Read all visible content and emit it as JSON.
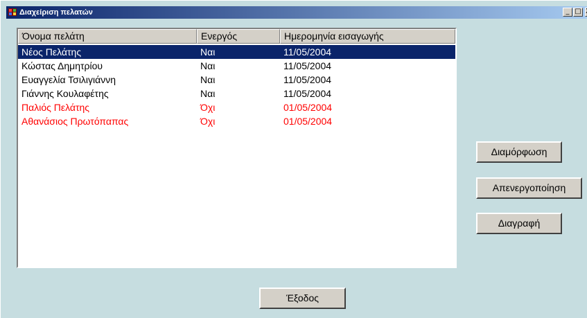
{
  "window": {
    "title": "Διαχείριση πελατών",
    "controls": {
      "minimize": "_",
      "maximize": "□",
      "close": "X"
    }
  },
  "list": {
    "columns": [
      "Όνομα πελάτη",
      "Ενεργός",
      "Ημερομηνία εισαγωγής"
    ],
    "rows": [
      {
        "name": "Νέος Πελάτης",
        "active": "Ναι",
        "date": "11/05/2004"
      },
      {
        "name": "Κώστας Δημητρίου",
        "active": "Ναι",
        "date": "11/05/2004"
      },
      {
        "name": "Ευαγγελία Τσιλιγιάννη",
        "active": "Ναι",
        "date": "11/05/2004"
      },
      {
        "name": "Γιάννης Κουλαφέτης",
        "active": "Ναι",
        "date": "11/05/2004"
      },
      {
        "name": "Παλιός Πελάτης",
        "active": "Όχι",
        "date": "01/05/2004"
      },
      {
        "name": "Αθανάσιος Πρωτόπαπας",
        "active": "Όχι",
        "date": "01/05/2004"
      }
    ],
    "selected_row": 0,
    "colors": {
      "selection": "#0a246a",
      "inactive_text": "#ff0000"
    }
  },
  "buttons": {
    "configure": "Διαμόρφωση",
    "deactivate": "Απενεργοποίηση",
    "delete": "Διαγραφή",
    "exit": "Έξοδος"
  },
  "icons": {
    "app": "app-window-icon"
  }
}
